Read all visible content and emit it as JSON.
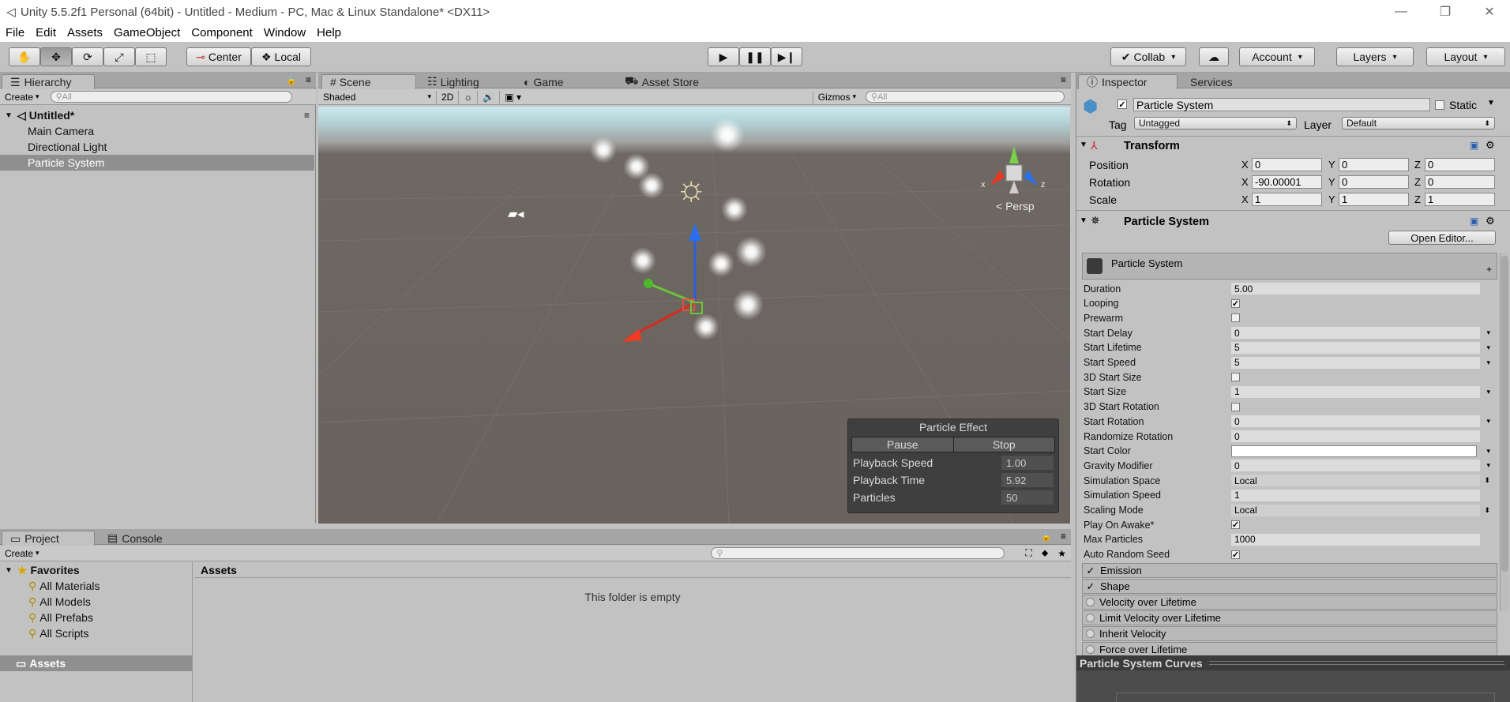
{
  "window": {
    "title": "Unity 5.5.2f1 Personal (64bit) - Untitled - Medium - PC, Mac & Linux Standalone* <DX11>"
  },
  "menu": [
    "File",
    "Edit",
    "Assets",
    "GameObject",
    "Component",
    "Window",
    "Help"
  ],
  "toolbar": {
    "pivot": "Center",
    "space": "Local",
    "collab": "Collab",
    "account": "Account",
    "layers": "Layers",
    "layout": "Layout"
  },
  "hierarchy": {
    "tab": "Hierarchy",
    "create": "Create",
    "search_placeholder": "All",
    "scene": "Untitled*",
    "items": [
      "Main Camera",
      "Directional Light",
      "Particle System"
    ],
    "selected_index": 2
  },
  "scene_view": {
    "tabs": [
      "Scene",
      "Lighting",
      "Game",
      "Asset Store"
    ],
    "shading": "Shaded",
    "mode_2d": "2D",
    "gizmos": "Gizmos",
    "search_placeholder": "All",
    "persp": "Persp",
    "particle_effect": {
      "title": "Particle Effect",
      "pause": "Pause",
      "stop": "Stop",
      "rows": [
        {
          "label": "Playback Speed",
          "value": "1.00"
        },
        {
          "label": "Playback Time",
          "value": "5.92"
        },
        {
          "label": "Particles",
          "value": "50"
        }
      ]
    }
  },
  "project": {
    "tabs": [
      "Project",
      "Console"
    ],
    "create": "Create",
    "favorites": "Favorites",
    "favorite_items": [
      "All Materials",
      "All Models",
      "All Prefabs",
      "All Scripts"
    ],
    "assets_root": "Assets",
    "assets_header": "Assets",
    "empty_message": "This folder is empty"
  },
  "inspector": {
    "tabs": [
      "Inspector",
      "Services"
    ],
    "object_name": "Particle System",
    "static_label": "Static",
    "tag_label": "Tag",
    "tag_value": "Untagged",
    "layer_label": "Layer",
    "layer_value": "Default",
    "transform": {
      "title": "Transform",
      "position": {
        "label": "Position",
        "x": "0",
        "y": "0",
        "z": "0"
      },
      "rotation": {
        "label": "Rotation",
        "x": "-90.00001",
        "y": "0",
        "z": "0"
      },
      "scale": {
        "label": "Scale",
        "x": "1",
        "y": "1",
        "z": "1"
      }
    },
    "particle_component": {
      "title": "Particle System",
      "open_editor": "Open Editor...",
      "main_module": "Particle System",
      "properties": [
        {
          "label": "Duration",
          "value": "5.00",
          "kind": "text"
        },
        {
          "label": "Looping",
          "value": "✓",
          "kind": "check"
        },
        {
          "label": "Prewarm",
          "value": "",
          "kind": "check"
        },
        {
          "label": "Start Delay",
          "value": "0",
          "kind": "drop"
        },
        {
          "label": "Start Lifetime",
          "value": "5",
          "kind": "drop"
        },
        {
          "label": "Start Speed",
          "value": "5",
          "kind": "drop"
        },
        {
          "label": "3D Start Size",
          "value": "",
          "kind": "check"
        },
        {
          "label": "Start Size",
          "value": "1",
          "kind": "drop"
        },
        {
          "label": "3D Start Rotation",
          "value": "",
          "kind": "check"
        },
        {
          "label": "Start Rotation",
          "value": "0",
          "kind": "drop"
        },
        {
          "label": "Randomize Rotation",
          "value": "0",
          "kind": "text"
        },
        {
          "label": "Start Color",
          "value": "",
          "kind": "color"
        },
        {
          "label": "Gravity Modifier",
          "value": "0",
          "kind": "drop"
        },
        {
          "label": "Simulation Space",
          "value": "Local",
          "kind": "select"
        },
        {
          "label": "Simulation Speed",
          "value": "1",
          "kind": "text"
        },
        {
          "label": "Scaling Mode",
          "value": "Local",
          "kind": "select"
        },
        {
          "label": "Play On Awake*",
          "value": "✓",
          "kind": "check"
        },
        {
          "label": "Max Particles",
          "value": "1000",
          "kind": "text"
        },
        {
          "label": "Auto Random Seed",
          "value": "✓",
          "kind": "check"
        }
      ],
      "modules": [
        {
          "label": "Emission",
          "enabled": true
        },
        {
          "label": "Shape",
          "enabled": true
        },
        {
          "label": "Velocity over Lifetime",
          "enabled": false
        },
        {
          "label": "Limit Velocity over Lifetime",
          "enabled": false
        },
        {
          "label": "Inherit Velocity",
          "enabled": false
        },
        {
          "label": "Force over Lifetime",
          "enabled": false
        }
      ]
    },
    "curves_title": "Particle System Curves"
  },
  "colors": {
    "panel": "#c2c2c2",
    "selection": "#8f8f8f",
    "scene_ground": "#69625d",
    "overlay": "#3f3f3f"
  }
}
